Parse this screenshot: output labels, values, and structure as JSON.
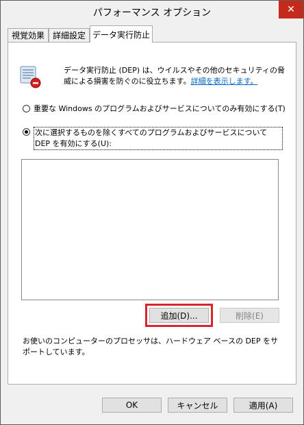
{
  "window": {
    "title": "パフォーマンス オプション"
  },
  "tabs": [
    {
      "label": "視覚効果"
    },
    {
      "label": "詳細設定"
    },
    {
      "label": "データ実行防止"
    }
  ],
  "dep": {
    "icon": "dep-shield-icon",
    "description": "データ実行防止 (DEP) は、ウイルスやその他のセキュリティの脅威による損害を防ぐのに役立ちます。",
    "details_link": "詳細を表示します。"
  },
  "options": {
    "option1": "重要な Windows のプログラムおよびサービスについてのみ有効にする(T)",
    "option2": "次に選択するものを除くすべてのプログラムおよびサービスについて DEP を有効にする(U):",
    "selected": "option2"
  },
  "buttons": {
    "add": "追加(D)...",
    "remove": "削除(E)",
    "ok": "OK",
    "cancel": "キャンセル",
    "apply": "適用(A)"
  },
  "footer": {
    "support_text": "お使いのコンピューターのプロセッサは、ハードウェア ベースの DEP をサポートしています。"
  },
  "colors": {
    "close": "#c42b1c",
    "highlight": "#d9232f",
    "link": "#0066cc"
  }
}
